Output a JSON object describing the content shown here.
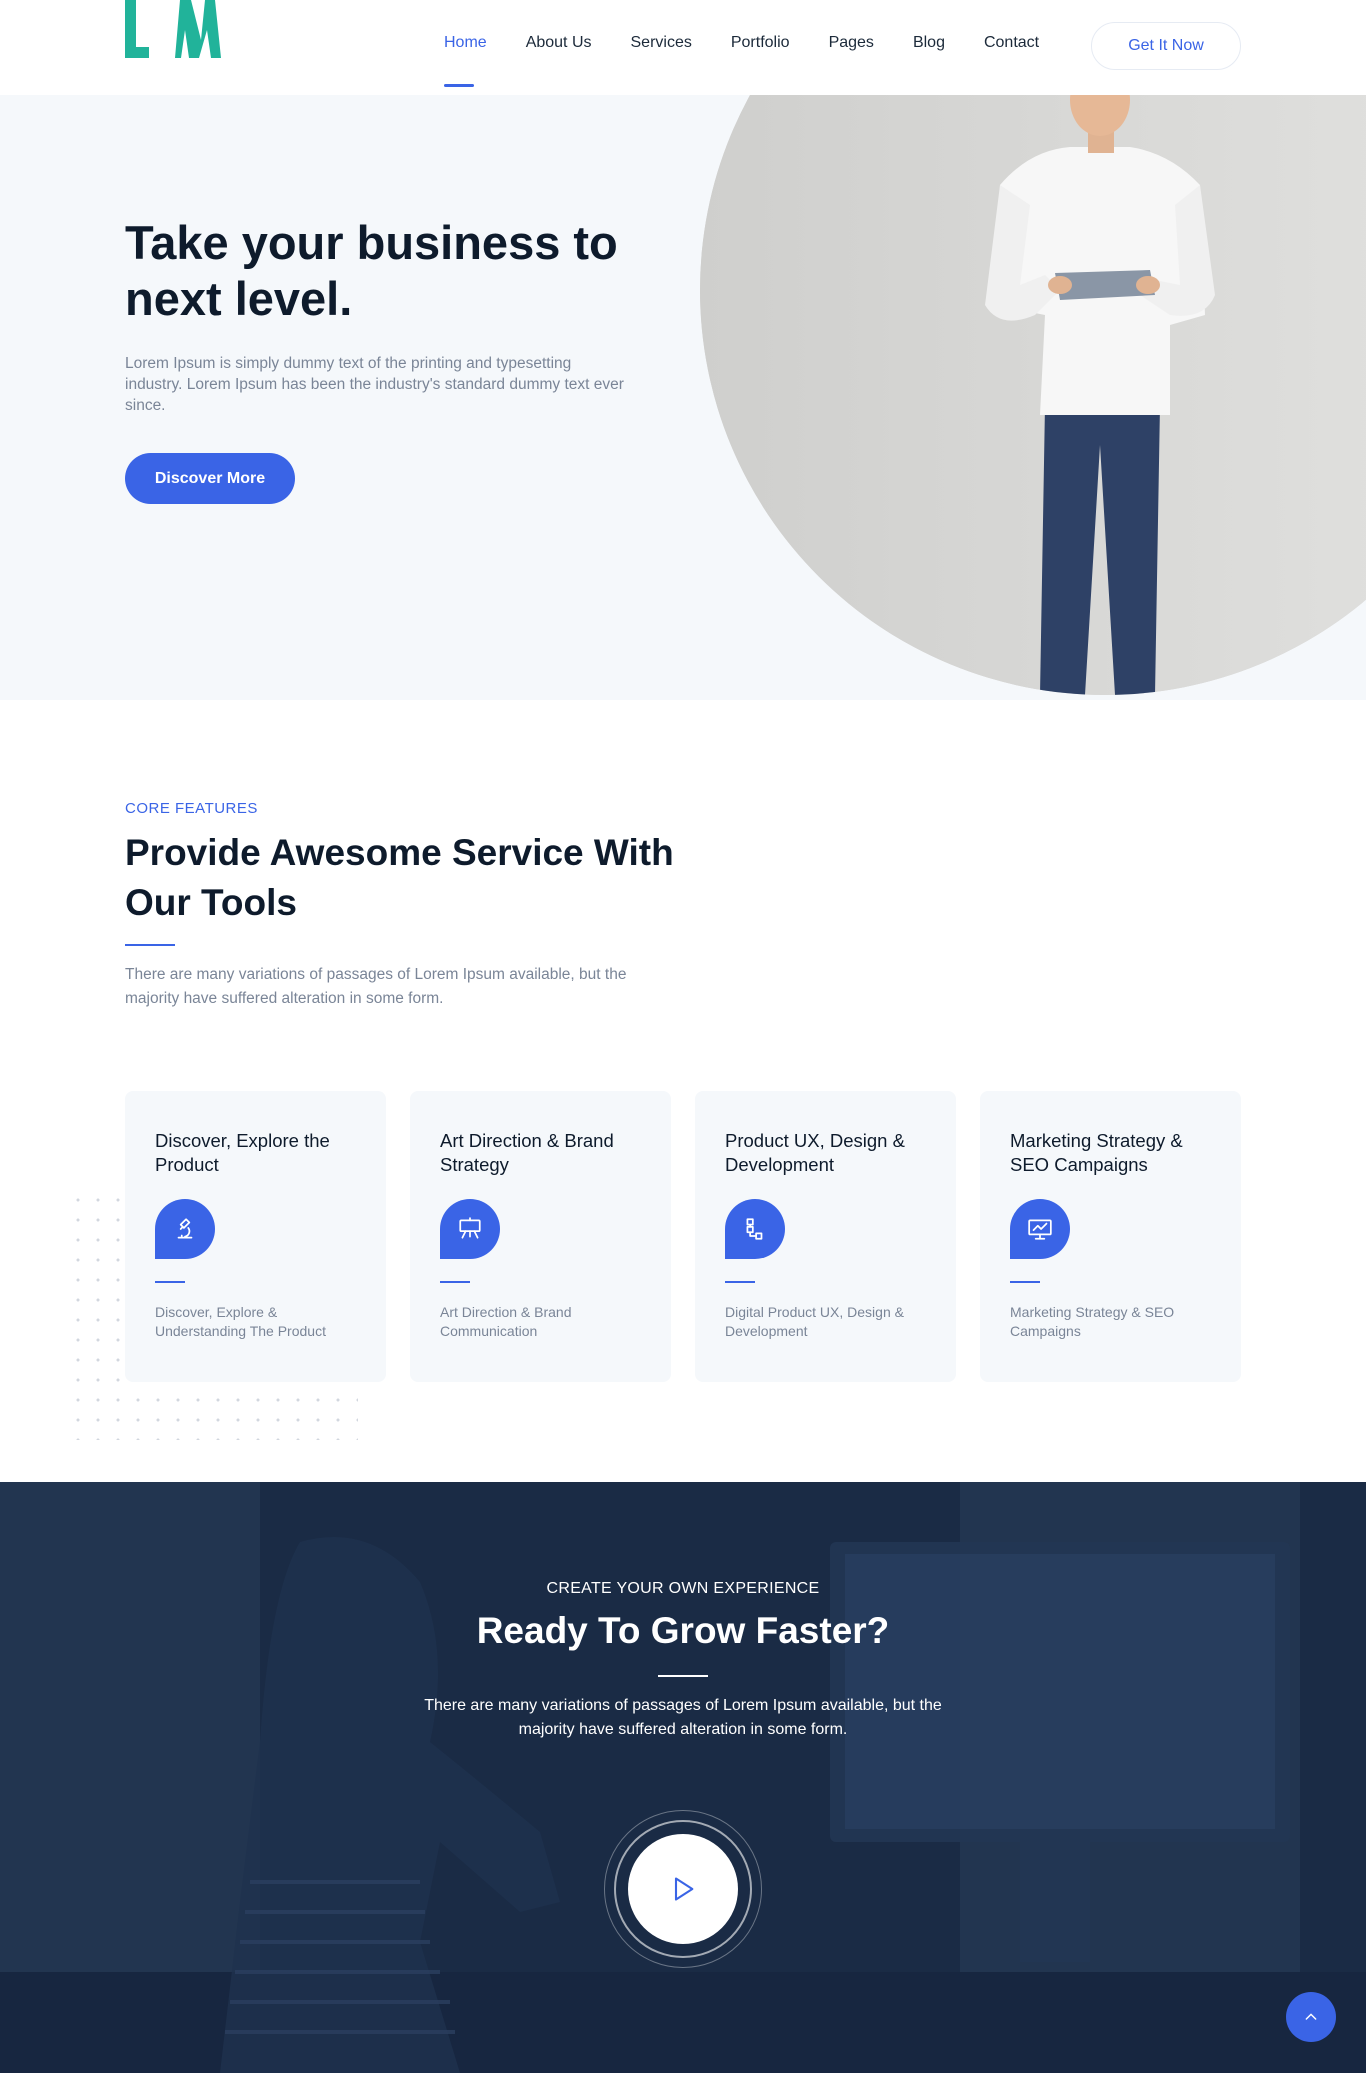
{
  "header": {
    "logo_text": "LW",
    "nav": [
      {
        "label": "Home",
        "active": true
      },
      {
        "label": "About Us",
        "active": false
      },
      {
        "label": "Services",
        "active": false
      },
      {
        "label": "Portfolio",
        "active": false
      },
      {
        "label": "Pages",
        "active": false
      },
      {
        "label": "Blog",
        "active": false
      },
      {
        "label": "Contact",
        "active": false
      }
    ],
    "cta_label": "Get It Now"
  },
  "hero": {
    "title": "Take your business to next level.",
    "text": "Lorem Ipsum is simply dummy text of the printing and typesetting industry. Lorem Ipsum has been the industry's standard dummy text ever since.",
    "button_label": "Discover More"
  },
  "features": {
    "eyebrow": "CORE FEATURES",
    "title": "Provide Awesome Service With Our Tools",
    "text": "There are many variations of passages of Lorem Ipsum available, but the majority have suffered alteration in some form.",
    "cards": [
      {
        "title": "Discover, Explore the Product",
        "icon": "microscope-icon",
        "text": "Discover, Explore & Understanding The Product"
      },
      {
        "title": "Art Direction & Brand Strategy",
        "icon": "presentation-board-icon",
        "text": "Art Direction & Brand Communication"
      },
      {
        "title": "Product UX, Design & Development",
        "icon": "flowchart-icon",
        "text": "Digital Product UX, Design & Development"
      },
      {
        "title": "Marketing Strategy & SEO Campaigns",
        "icon": "monitor-chart-icon",
        "text": "Marketing Strategy & SEO Campaigns"
      }
    ]
  },
  "cta": {
    "eyebrow": "CREATE YOUR OWN EXPERIENCE",
    "title": "Ready To Grow Faster?",
    "text": "There are many variations of passages of Lorem Ipsum available, but the majority have suffered alteration in some form."
  },
  "colors": {
    "accent": "#3a64e6",
    "logo": "#21b39a",
    "dark": "#1a2b45",
    "light_bg": "#f5f8fb"
  }
}
